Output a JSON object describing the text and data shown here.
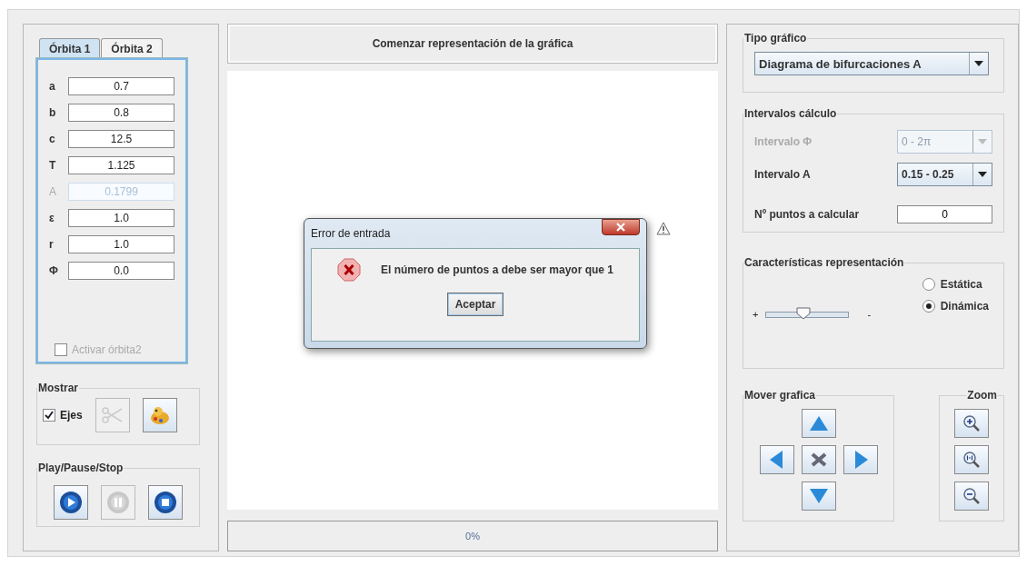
{
  "tabs": [
    {
      "label": "Órbita 1",
      "selected": true
    },
    {
      "label": "Órbita 2",
      "selected": false
    }
  ],
  "params": [
    {
      "label": "a",
      "value": "0.7",
      "disabled": false
    },
    {
      "label": "b",
      "value": "0.8",
      "disabled": false
    },
    {
      "label": "c",
      "value": "12.5",
      "disabled": false
    },
    {
      "label": "T",
      "value": "1.125",
      "disabled": false
    },
    {
      "label": "A",
      "value": "0.1799",
      "disabled": true
    },
    {
      "label": "ε",
      "value": "1.0",
      "disabled": false
    },
    {
      "label": "r",
      "value": "1.0",
      "disabled": false
    },
    {
      "label": "Φ",
      "value": "0.0",
      "disabled": false
    }
  ],
  "activar_orbita2": {
    "label": "Activar órbita2",
    "checked": false,
    "disabled": true
  },
  "mostrar": {
    "title": "Mostrar",
    "ejes": {
      "label": "Ejes",
      "checked": true
    },
    "buttons": [
      {
        "kind": "scissors",
        "disabled": true
      },
      {
        "kind": "palette",
        "disabled": false
      }
    ]
  },
  "playback": {
    "title": "Play/Pause/Stop",
    "buttons": [
      {
        "kind": "play",
        "disabled": false
      },
      {
        "kind": "pause",
        "disabled": true
      },
      {
        "kind": "stop",
        "disabled": false
      }
    ]
  },
  "start_button": "Comenzar representación de la gráfica",
  "progress": {
    "text": "0%",
    "level": 0
  },
  "dialog": {
    "title": "Error de entrada",
    "message": "El número de puntos a debe ser mayor que 1",
    "button": "Aceptar"
  },
  "tipo_grafico": {
    "title": "Tipo gráfico",
    "value": "Diagrama de bifurcaciones A"
  },
  "intervalos": {
    "title": "Intervalos cálculo",
    "rows": [
      {
        "label": "Intervalo Φ",
        "value": "0 - 2π",
        "disabled": true
      },
      {
        "label": "Intervalo A",
        "value": "0.15 - 0.25",
        "disabled": false
      }
    ],
    "points": {
      "label": "Nº puntos a calcular",
      "value": "0"
    }
  },
  "representacion": {
    "title": "Características representación",
    "slider": {
      "min_label": "+",
      "max_label": "-",
      "level": 0.45
    },
    "modes": [
      {
        "label": "Estática",
        "selected": false
      },
      {
        "label": "Dinámica",
        "selected": true
      }
    ]
  },
  "mover": {
    "title": "Mover grafica",
    "buttons": [
      {
        "kind": "up"
      },
      {
        "kind": "left"
      },
      {
        "kind": "center"
      },
      {
        "kind": "right"
      },
      {
        "kind": "down"
      }
    ]
  },
  "zoom": {
    "title": "Zoom",
    "buttons": [
      {
        "kind": "zoom-in"
      },
      {
        "kind": "zoom-reset"
      },
      {
        "kind": "zoom-out"
      }
    ]
  }
}
